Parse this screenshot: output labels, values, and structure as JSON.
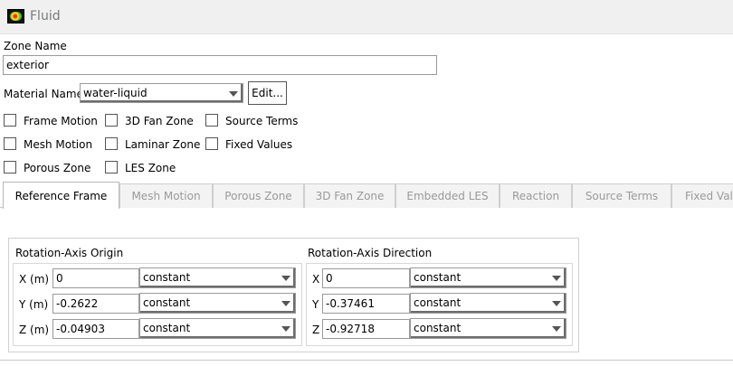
{
  "window": {
    "title": "Fluid"
  },
  "zone": {
    "label": "Zone Name",
    "value": "exterior"
  },
  "material": {
    "label": "Material Name",
    "value": "water-liquid",
    "edit_label": "Edit..."
  },
  "options": [
    {
      "label": "Frame Motion",
      "checked": false
    },
    {
      "label": "3D Fan Zone",
      "checked": false
    },
    {
      "label": "Source Terms",
      "checked": false
    },
    {
      "label": "Mesh Motion",
      "checked": false
    },
    {
      "label": "Laminar Zone",
      "checked": false
    },
    {
      "label": "Fixed Values",
      "checked": false
    },
    {
      "label": "Porous Zone",
      "checked": false
    },
    {
      "label": "LES Zone",
      "checked": false
    }
  ],
  "tabs": [
    {
      "label": "Reference Frame",
      "active": true
    },
    {
      "label": "Mesh Motion",
      "active": false
    },
    {
      "label": "Porous Zone",
      "active": false
    },
    {
      "label": "3D Fan Zone",
      "active": false
    },
    {
      "label": "Embedded LES",
      "active": false
    },
    {
      "label": "Reaction",
      "active": false
    },
    {
      "label": "Source Terms",
      "active": false
    },
    {
      "label": "Fixed Val",
      "active": false
    }
  ],
  "origin": {
    "title": "Rotation-Axis Origin",
    "rows": [
      {
        "label": "X (m)",
        "value": "0",
        "method": "constant"
      },
      {
        "label": "Y (m)",
        "value": "-0.2622",
        "method": "constant"
      },
      {
        "label": "Z (m)",
        "value": "-0.04903",
        "method": "constant"
      }
    ]
  },
  "direction": {
    "title": "Rotation-Axis Direction",
    "rows": [
      {
        "label": "X",
        "value": "0",
        "method": "constant"
      },
      {
        "label": "Y",
        "value": "-0.37461",
        "method": "constant"
      },
      {
        "label": "Z",
        "value": "-0.92718",
        "method": "constant"
      }
    ]
  }
}
